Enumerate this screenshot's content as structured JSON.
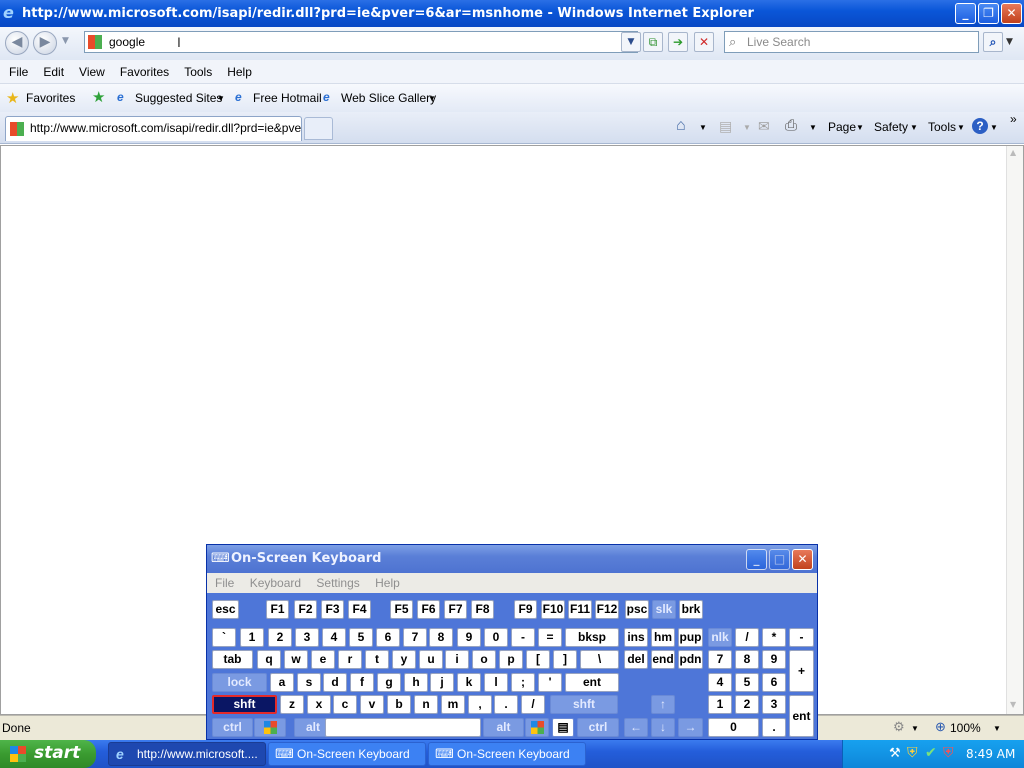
{
  "window": {
    "title": "http://www.microsoft.com/isapi/redir.dll?prd=ie&pver=6&ar=msnhome - Windows Internet Explorer"
  },
  "address": {
    "value": "google",
    "search_placeholder": "Live Search"
  },
  "menu": [
    "File",
    "Edit",
    "View",
    "Favorites",
    "Tools",
    "Help"
  ],
  "favorites_bar": {
    "favorites": "Favorites",
    "items": [
      "Suggested Sites",
      "Free Hotmail",
      "Web Slice Gallery"
    ]
  },
  "tab": {
    "title": "http://www.microsoft.com/isapi/redir.dll?prd=ie&pver..."
  },
  "commands": {
    "page": "Page",
    "safety": "Safety",
    "tools": "Tools"
  },
  "status": {
    "text": "Done",
    "zoom": "100%"
  },
  "taskbar": {
    "start": "start",
    "tasks": [
      "http://www.microsoft....",
      "On-Screen Keyboard",
      "On-Screen Keyboard"
    ],
    "clock": "8:49 AM",
    "help_icon": "?"
  },
  "osk": {
    "title": "On-Screen Keyboard",
    "menu": [
      "File",
      "Keyboard",
      "Settings",
      "Help"
    ],
    "row1": [
      "esc",
      "F1",
      "F2",
      "F3",
      "F4",
      "F5",
      "F6",
      "F7",
      "F8",
      "F9",
      "F10",
      "F11",
      "F12",
      "psc",
      "slk",
      "brk"
    ],
    "row2": [
      "`",
      "1",
      "2",
      "3",
      "4",
      "5",
      "6",
      "7",
      "8",
      "9",
      "0",
      "-",
      "=",
      "bksp",
      "ins",
      "hm",
      "pup",
      "nlk",
      "/",
      "*",
      "-"
    ],
    "row3": [
      "tab",
      "q",
      "w",
      "e",
      "r",
      "t",
      "y",
      "u",
      "i",
      "o",
      "p",
      "[",
      "]",
      "\\",
      "del",
      "end",
      "pdn",
      "7",
      "8",
      "9",
      "+"
    ],
    "row4": [
      "lock",
      "a",
      "s",
      "d",
      "f",
      "g",
      "h",
      "j",
      "k",
      "l",
      ";",
      "'",
      "ent",
      "4",
      "5",
      "6"
    ],
    "row5": [
      "shft",
      "z",
      "x",
      "c",
      "v",
      "b",
      "n",
      "m",
      ",",
      ".",
      "/",
      "shft",
      "↑",
      "1",
      "2",
      "3",
      "ent"
    ],
    "row6": [
      "ctrl",
      "alt",
      "alt",
      "ctrl",
      "←",
      "↓",
      "→",
      "0",
      "."
    ]
  },
  "colors": {
    "title_bar": "#0a56d8",
    "taskbar": "#245edb",
    "start": "#3a9b30",
    "osk_key_selected": "#0a1664"
  }
}
